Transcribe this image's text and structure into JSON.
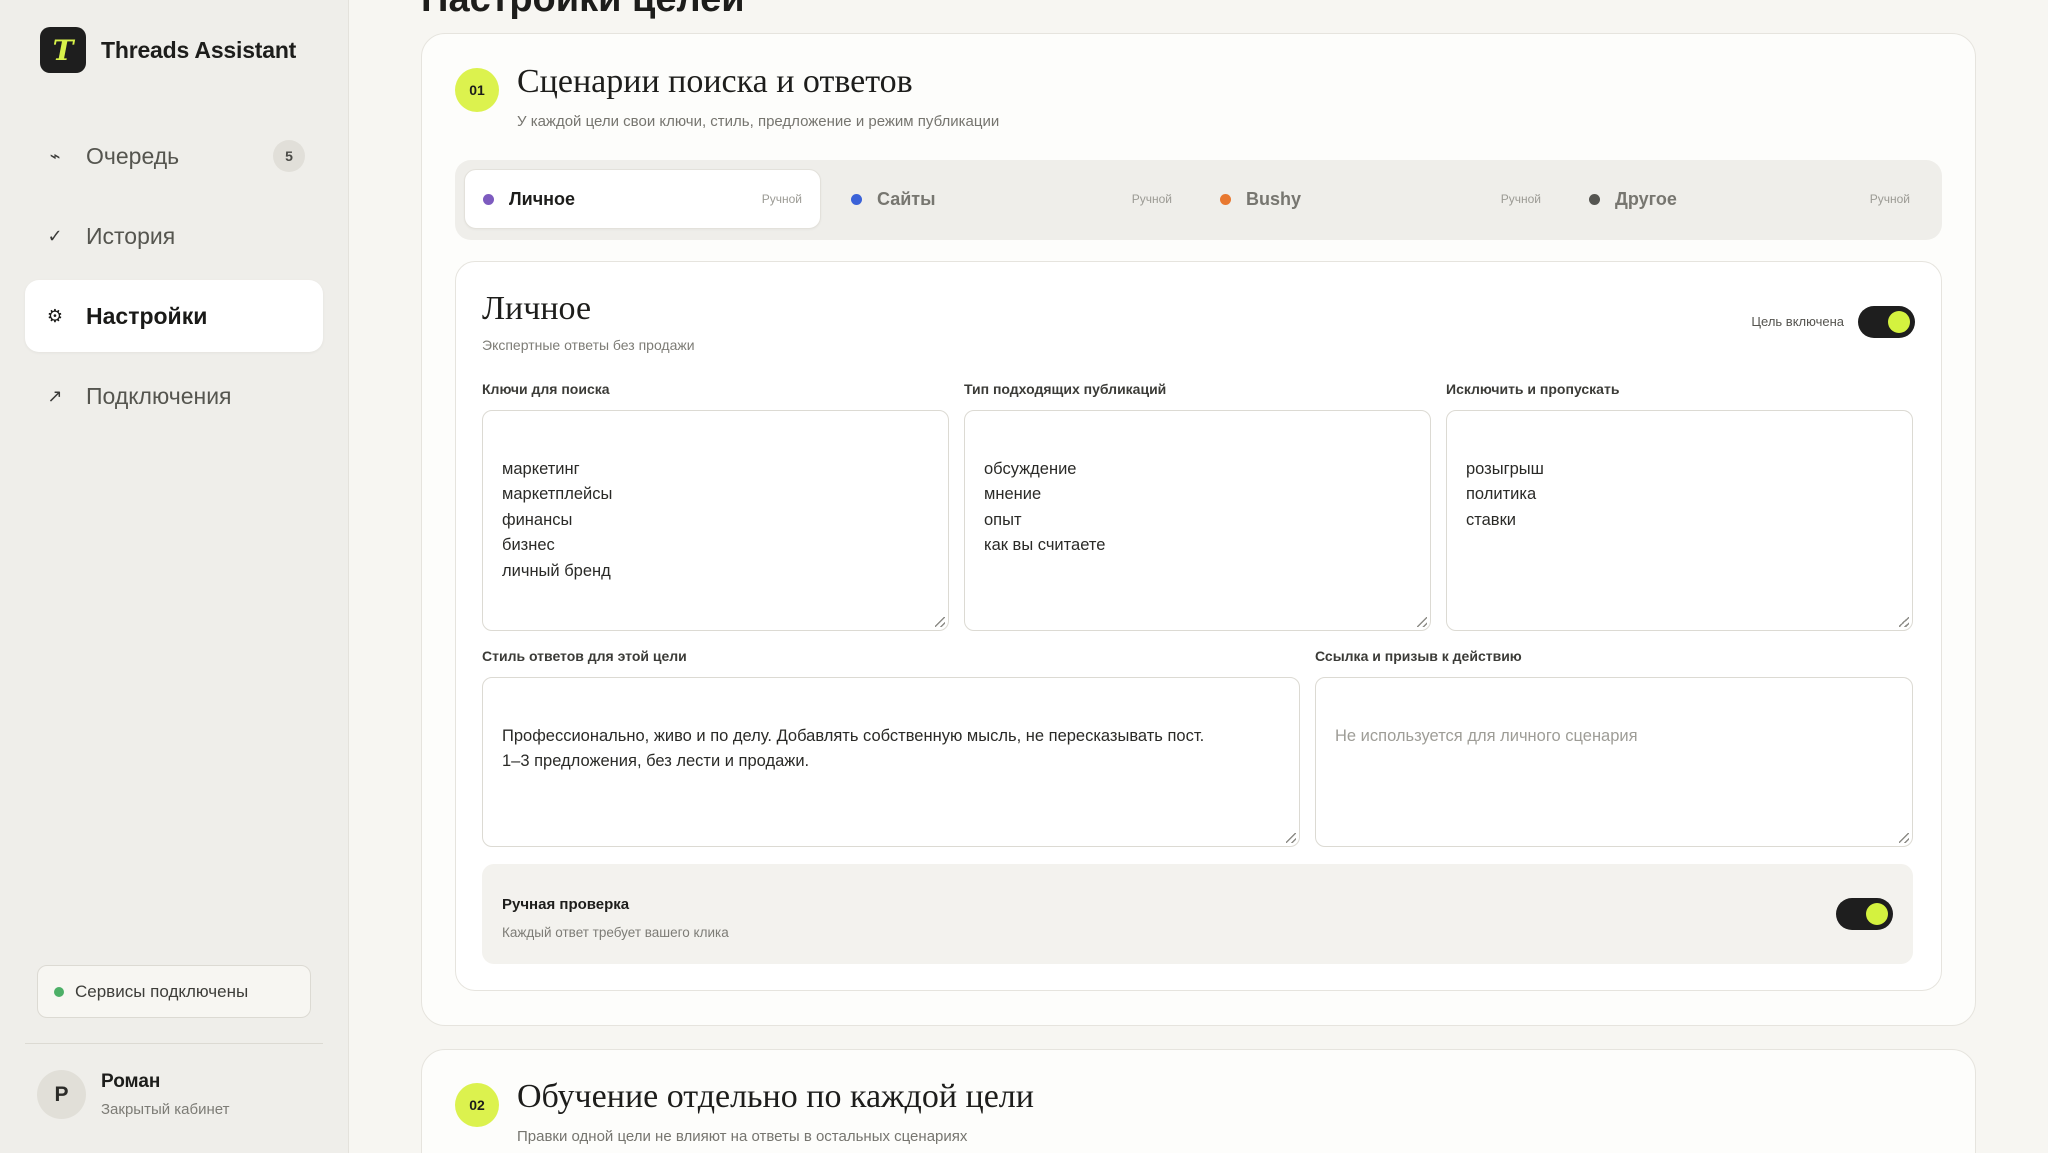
{
  "brand": {
    "logo_letter": "T",
    "name": "Threads Assistant"
  },
  "sidebar": {
    "items": [
      {
        "icon": "activity-icon",
        "glyph": "⌁",
        "label": "Очередь",
        "badge": "5"
      },
      {
        "icon": "check-icon",
        "glyph": "✓",
        "label": "История"
      },
      {
        "icon": "gear-icon",
        "glyph": "⚙",
        "label": "Настройки",
        "active": true
      },
      {
        "icon": "arrow-up-right-icon",
        "glyph": "↗",
        "label": "Подключения"
      }
    ],
    "status": "Сервисы подключены",
    "user": {
      "initial": "Р",
      "name": "Роман",
      "subtitle": "Закрытый кабинет"
    }
  },
  "page": {
    "title": "Настройки целей"
  },
  "section1": {
    "number": "01",
    "title": "Сценарии поиска и ответов",
    "subtitle": "У каждой цели свои ключи, стиль, предложение и режим публикации",
    "tabs": [
      {
        "label": "Личное",
        "mode": "Ручной",
        "color": "#7d5bbf",
        "active": true
      },
      {
        "label": "Сайты",
        "mode": "Ручной",
        "color": "#3b62d8"
      },
      {
        "label": "Bushy",
        "mode": "Ручной",
        "color": "#e87830"
      },
      {
        "label": "Другое",
        "mode": "Ручной",
        "color": "#555551"
      }
    ],
    "goal": {
      "title": "Личное",
      "subtitle": "Экспертные ответы без продажи",
      "enabled_label": "Цель включена",
      "enabled": true,
      "keywords_label": "Ключи для поиска",
      "keywords": "маркетинг\nмаркетплейсы\nфинансы\nбизнес\nличный бренд",
      "post_types_label": "Тип подходящих публикаций",
      "post_types": "обсуждение\nмнение\nопыт\nкак вы считаете",
      "exclude_label": "Исключить и пропускать",
      "exclude": "розыгрыш\nполитика\nставки",
      "style_label": "Стиль ответов для этой цели",
      "style": "Профессионально, живо и по делу. Добавлять собственную мысль, не пересказывать пост.\n1–3 предложения, без лести и продажи.",
      "cta_label": "Ссылка и призыв к действию",
      "cta_placeholder": "Не используется для личного сценария",
      "manual_title": "Ручная проверка",
      "manual_subtitle": "Каждый ответ требует вашего клика",
      "manual_enabled": true
    }
  },
  "section2": {
    "number": "02",
    "title": "Обучение отдельно по каждой цели",
    "subtitle": "Правки одной цели не влияют на ответы в остальных сценариях"
  },
  "colors": {
    "accent": "#d4f23f",
    "status_ok": "#4caf67",
    "dark": "#1e1e1e"
  }
}
